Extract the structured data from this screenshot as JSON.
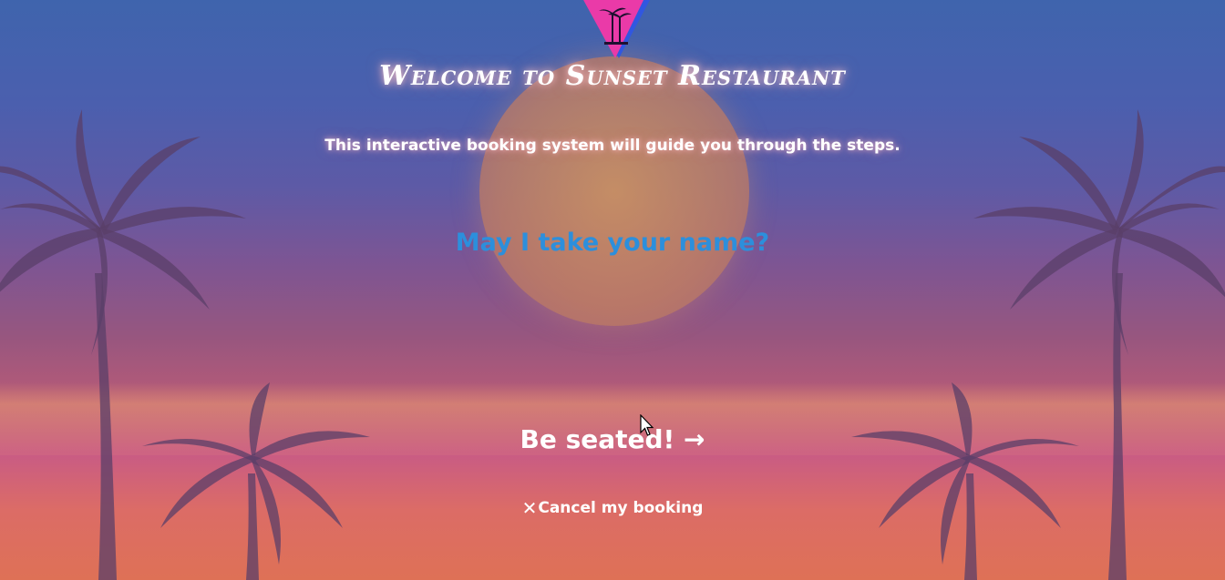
{
  "page": {
    "title": "Welcome to Sunset Restaurant",
    "subtitle": "This interactive booking system will guide you through the steps."
  },
  "form": {
    "name_placeholder": "May I take your name?",
    "name_value": ""
  },
  "actions": {
    "seat_label": "Be seated! →",
    "cancel_label": "Cancel my booking",
    "cancel_icon": "close-icon"
  },
  "colors": {
    "accent": "#2c8fdc",
    "logo_pink": "#ea3aa8",
    "logo_blue": "#3157e0",
    "palm_silhouette": "#5a3f68"
  }
}
